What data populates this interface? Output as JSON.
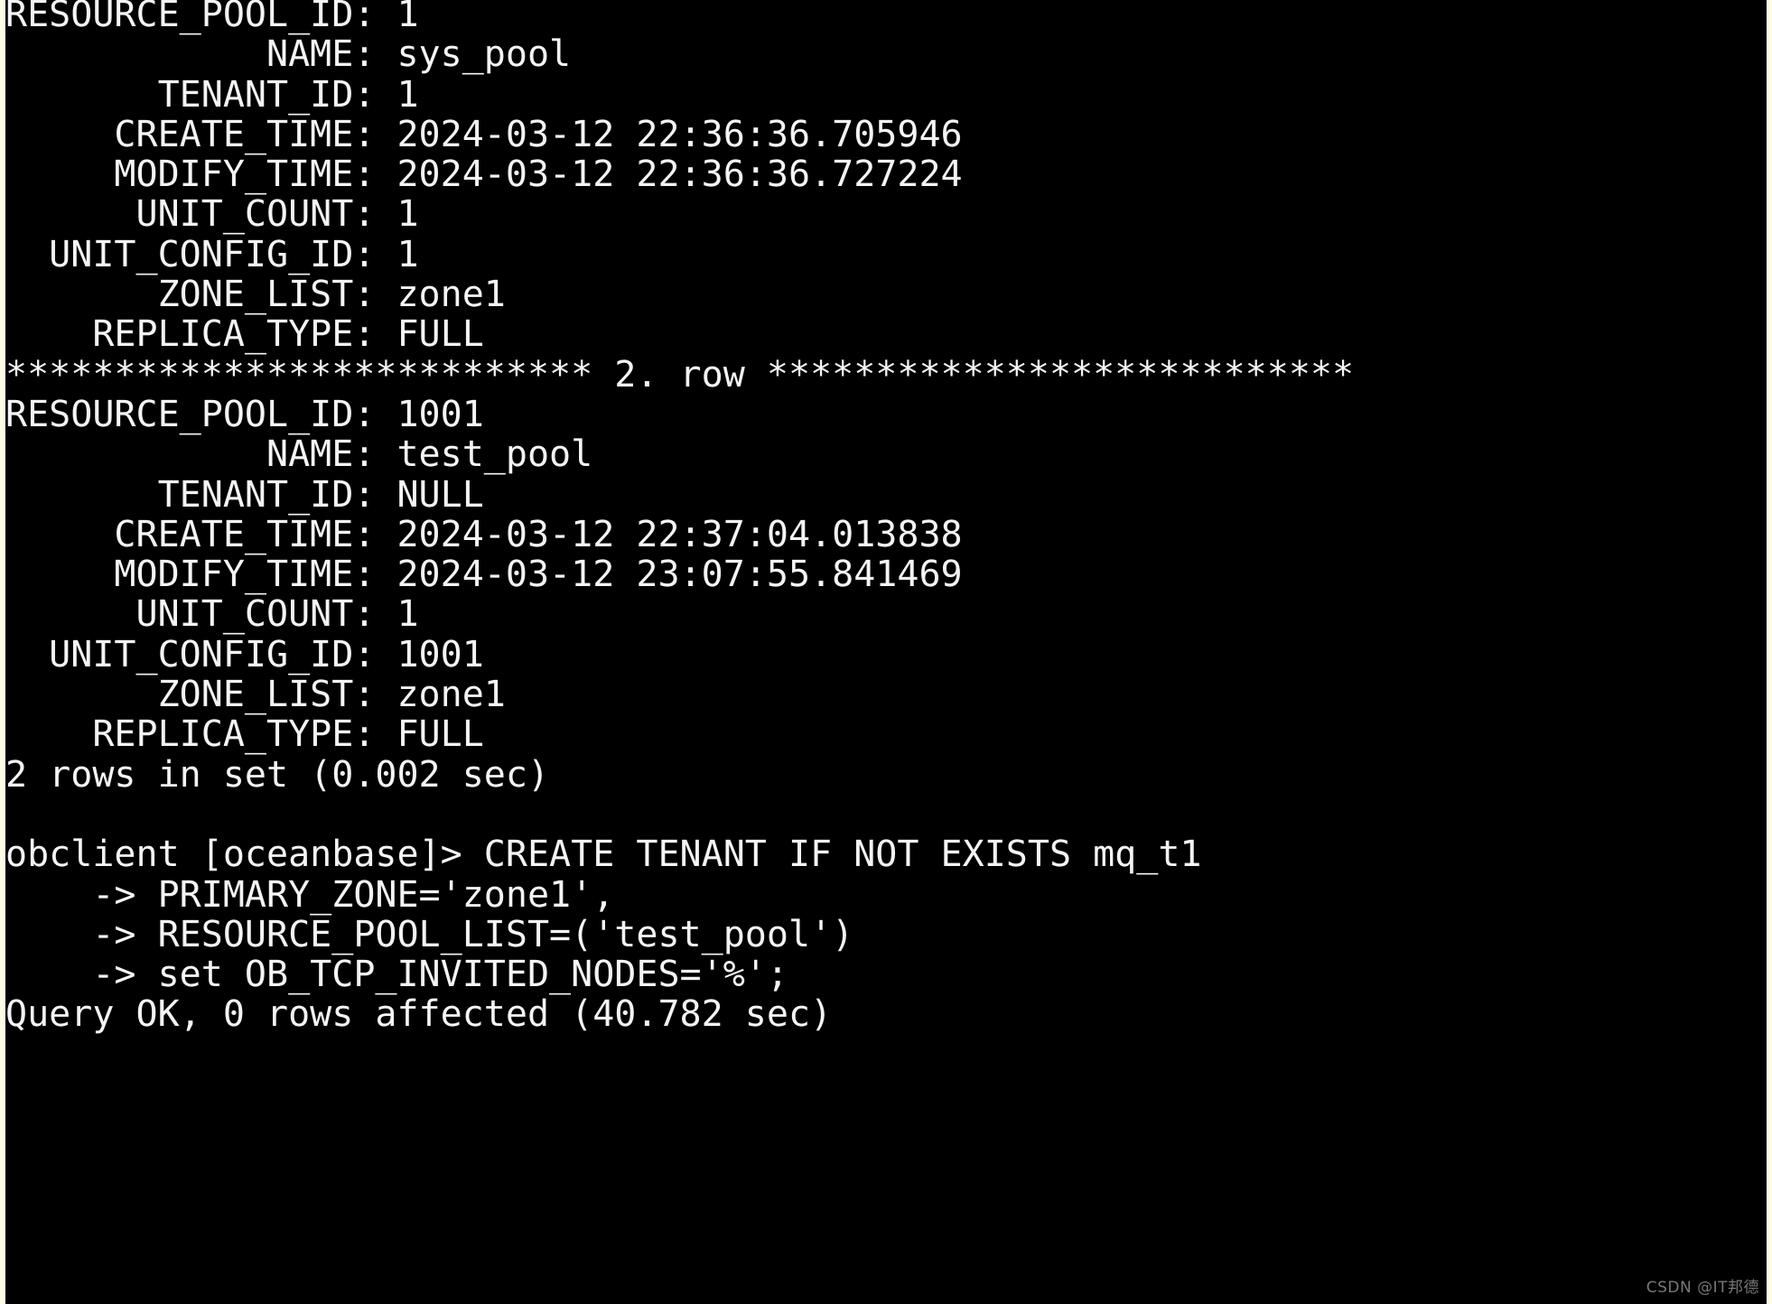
{
  "terminal": {
    "background_color": "#000000",
    "foreground_color": "#f4f4f4",
    "prompt": "obclient [oceanbase]> ",
    "continuation_prompt": "    -> "
  },
  "result_sets": [
    {
      "rows": [
        {
          "row_separator": null,
          "fields": [
            {
              "key": "RESOURCE_POOL_ID",
              "value": "1"
            },
            {
              "key": "NAME",
              "value": "sys_pool"
            },
            {
              "key": "TENANT_ID",
              "value": "1"
            },
            {
              "key": "CREATE_TIME",
              "value": "2024-03-12 22:36:36.705946"
            },
            {
              "key": "MODIFY_TIME",
              "value": "2024-03-12 22:36:36.727224"
            },
            {
              "key": "UNIT_COUNT",
              "value": "1"
            },
            {
              "key": "UNIT_CONFIG_ID",
              "value": "1"
            },
            {
              "key": "ZONE_LIST",
              "value": "zone1"
            },
            {
              "key": "REPLICA_TYPE",
              "value": "FULL"
            }
          ]
        },
        {
          "row_separator": "*************************** 2. row ***************************",
          "fields": [
            {
              "key": "RESOURCE_POOL_ID",
              "value": "1001"
            },
            {
              "key": "NAME",
              "value": "test_pool"
            },
            {
              "key": "TENANT_ID",
              "value": "NULL"
            },
            {
              "key": "CREATE_TIME",
              "value": "2024-03-12 22:37:04.013838"
            },
            {
              "key": "MODIFY_TIME",
              "value": "2024-03-12 23:07:55.841469"
            },
            {
              "key": "UNIT_COUNT",
              "value": "1"
            },
            {
              "key": "UNIT_CONFIG_ID",
              "value": "1001"
            },
            {
              "key": "ZONE_LIST",
              "value": "zone1"
            },
            {
              "key": "REPLICA_TYPE",
              "value": "FULL"
            }
          ]
        }
      ],
      "status": "2 rows in set (0.002 sec)"
    }
  ],
  "command": {
    "prompt_line": "obclient [oceanbase]> CREATE TENANT IF NOT EXISTS mq_t1",
    "continuation_lines": [
      "    -> PRIMARY_ZONE='zone1',",
      "    -> RESOURCE_POOL_LIST=('test_pool')",
      "    -> set OB_TCP_INVITED_NODES='%';"
    ],
    "result": "Query OK, 0 rows affected (40.782 sec)"
  },
  "lines": [
    "RESOURCE_POOL_ID: 1",
    "            NAME: sys_pool",
    "       TENANT_ID: 1",
    "     CREATE_TIME: 2024-03-12 22:36:36.705946",
    "     MODIFY_TIME: 2024-03-12 22:36:36.727224",
    "      UNIT_COUNT: 1",
    "  UNIT_CONFIG_ID: 1",
    "       ZONE_LIST: zone1",
    "    REPLICA_TYPE: FULL",
    "*************************** 2. row ***************************",
    "RESOURCE_POOL_ID: 1001",
    "            NAME: test_pool",
    "       TENANT_ID: NULL",
    "     CREATE_TIME: 2024-03-12 22:37:04.013838",
    "     MODIFY_TIME: 2024-03-12 23:07:55.841469",
    "      UNIT_COUNT: 1",
    "  UNIT_CONFIG_ID: 1001",
    "       ZONE_LIST: zone1",
    "    REPLICA_TYPE: FULL",
    "2 rows in set (0.002 sec)",
    " ",
    "obclient [oceanbase]> CREATE TENANT IF NOT EXISTS mq_t1",
    "    -> PRIMARY_ZONE='zone1',",
    "    -> RESOURCE_POOL_LIST=('test_pool')",
    "    -> set OB_TCP_INVITED_NODES='%';",
    "Query OK, 0 rows affected (40.782 sec)"
  ],
  "watermark": {
    "text": "CSDN @IT邦德"
  }
}
